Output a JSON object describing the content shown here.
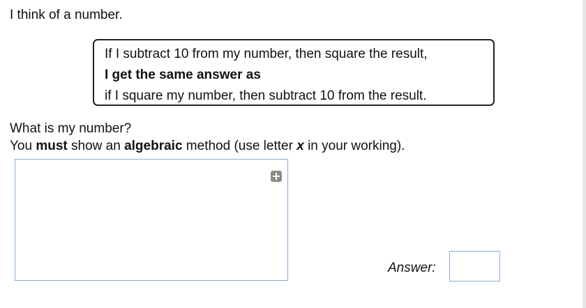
{
  "intro": "I think of a number.",
  "puzzle": {
    "line1": "If I subtract 10 from my number, then square the result,",
    "line2": "I get the same answer as",
    "line3": "if I square my number, then subtract 10 from the result."
  },
  "question": {
    "line1": "What is my number?",
    "line2_part1": "You ",
    "line2_must": "must",
    "line2_part2": " show an ",
    "line2_algebraic": "algebraic",
    "line2_part3": " method (use letter ",
    "line2_x": "x",
    "line2_part4": " in your working)."
  },
  "working": {
    "value": "",
    "expand_icon": "plus-square-icon"
  },
  "answer": {
    "label": "Answer:",
    "value": ""
  },
  "colors": {
    "input_border": "#8aaed4",
    "icon_gray": "#8c8c8c",
    "side_panel": "#e6e6e6"
  }
}
